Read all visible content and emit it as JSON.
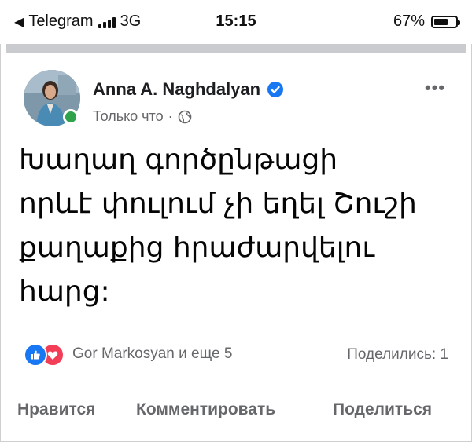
{
  "status_bar": {
    "back_app": "Telegram",
    "network": "3G",
    "time": "15:15",
    "battery_percent": "67%",
    "battery_level": 0.67
  },
  "post": {
    "author": "Anna A. Naghdalyan",
    "verified": true,
    "timestamp": "Только что",
    "privacy_icon": "globe-icon",
    "more_icon": "more-options-icon",
    "text_lines": [
      "Խաղաղ գործընթացի",
      "որևէ փուլում չի եղել Շուշի",
      "քաղաքից հրաժարվելու",
      "հարց:"
    ],
    "reactions": {
      "icons": [
        "like-icon",
        "love-icon"
      ],
      "summary": "Gor Markosyan и еще 5"
    },
    "shares": "Поделились: 1"
  },
  "actions": {
    "like": "Нравится",
    "comment": "Комментировать",
    "share": "Поделиться"
  },
  "colors": {
    "facebook_blue": "#1877f2",
    "love_red": "#f33e58",
    "online_green": "#31a24c",
    "secondary_text": "#65676b"
  }
}
